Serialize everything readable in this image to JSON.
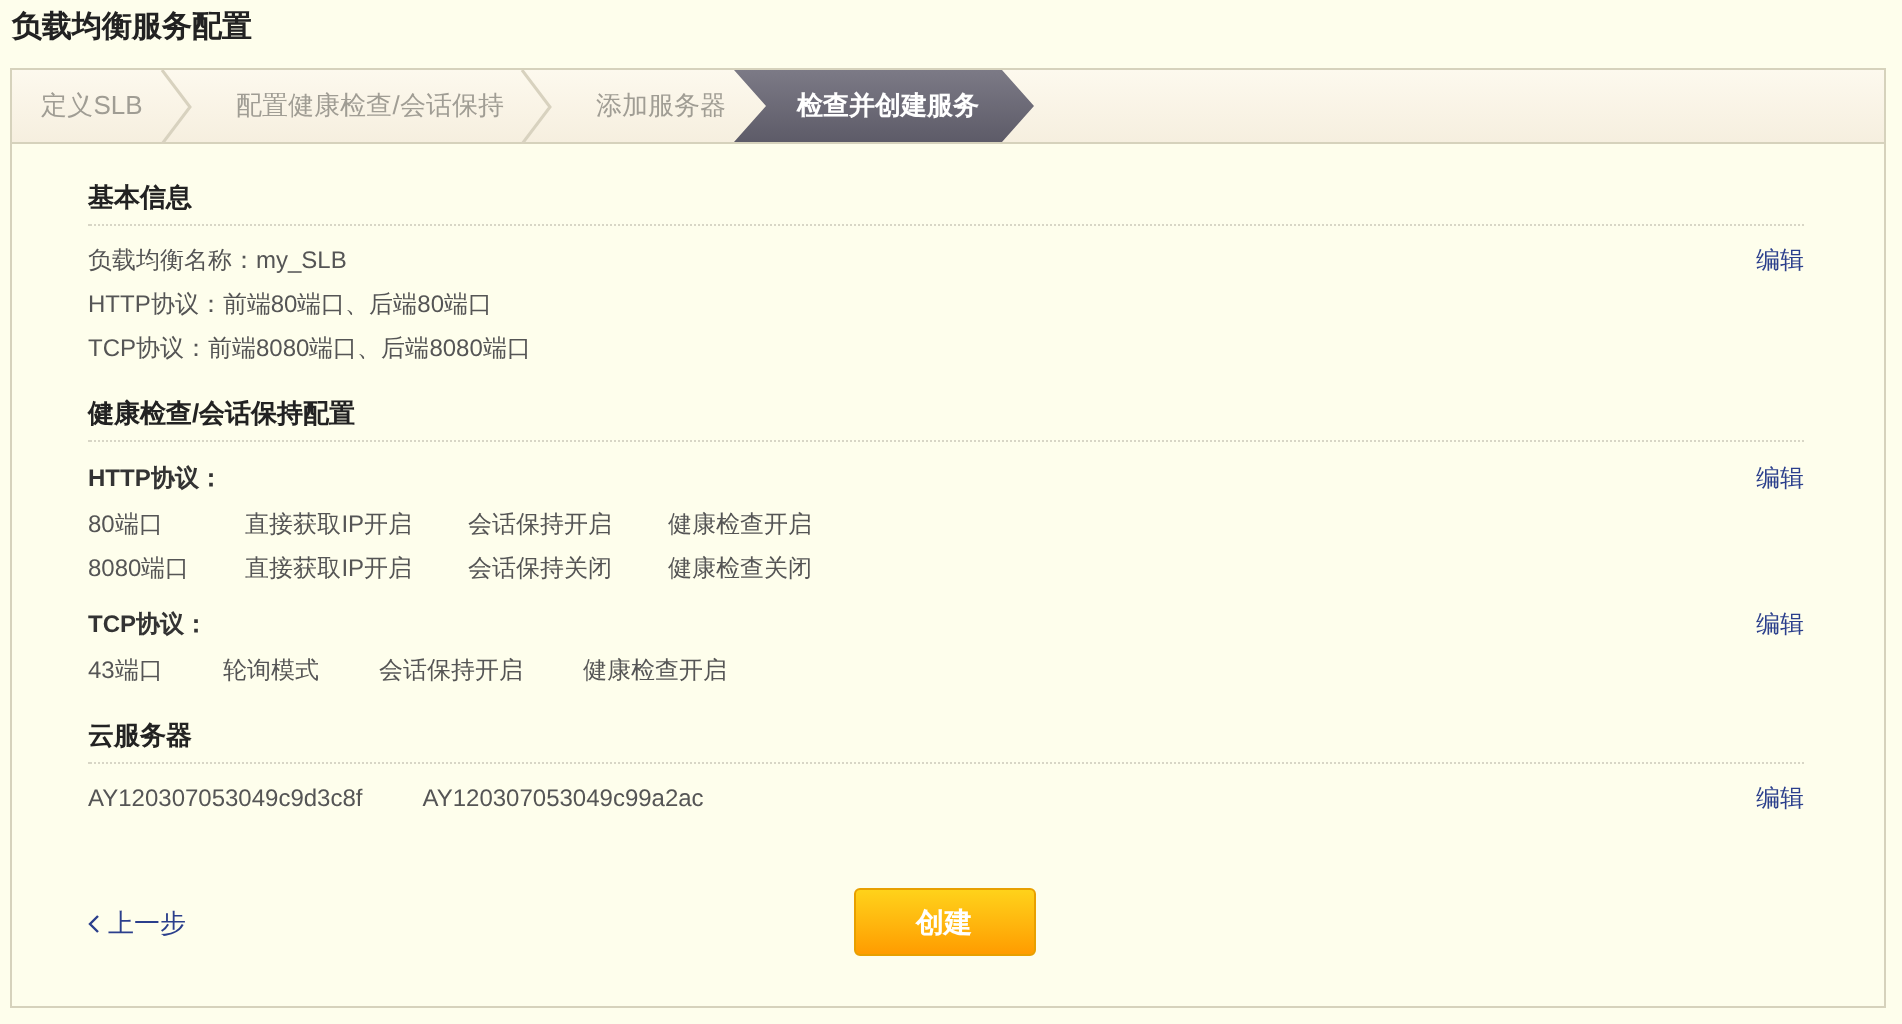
{
  "page_title": "负载均衡服务配置",
  "steps": [
    {
      "label": "定义SLB",
      "selected": false
    },
    {
      "label": "配置健康检查/会话保持",
      "selected": false
    },
    {
      "label": "添加服务器",
      "selected": false
    },
    {
      "label": "检查并创建服务",
      "selected": true
    }
  ],
  "sections": [
    {
      "title": "基本信息",
      "groups": [
        {
          "edit": "编辑",
          "rows": [
            [
              "负载均衡名称：my_SLB"
            ],
            [
              "HTTP协议：前端80端口、后端80端口"
            ],
            [
              "TCP协议：前端8080端口、后端8080端口"
            ]
          ]
        }
      ]
    },
    {
      "title": "健康检查/会话保持配置",
      "groups": [
        {
          "label": "HTTP协议：",
          "edit": "编辑",
          "rows": [
            [
              "80端口",
              "直接获取IP开启",
              "会话保持开启",
              "健康检查开启"
            ],
            [
              "8080端口",
              "直接获取IP开启",
              "会话保持关闭",
              "健康检查关闭"
            ]
          ]
        },
        {
          "label": "TCP协议：",
          "edit": "编辑",
          "rows": [
            [
              "43端口",
              "轮询模式",
              "会话保持开启",
              "健康检查开启"
            ]
          ]
        }
      ]
    },
    {
      "title": "云服务器",
      "groups": [
        {
          "edit": "编辑",
          "rows": [
            [
              "AY120307053049c9d3c8f",
              "AY120307053049c99a2ac"
            ]
          ]
        }
      ]
    }
  ],
  "back_link": "上一步",
  "create_button": "创建"
}
